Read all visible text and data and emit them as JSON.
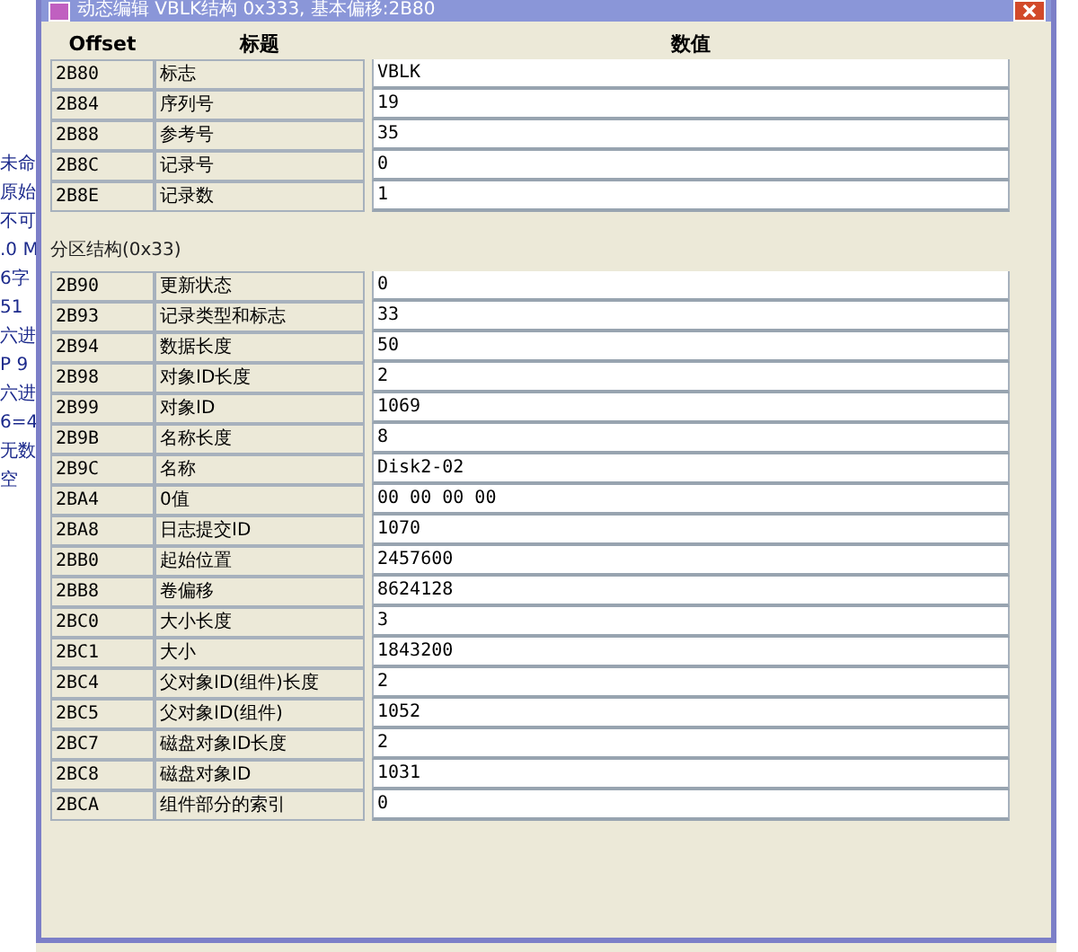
{
  "background_fragments": [
    "未命",
    "原始",
    "不可",
    ".0 M",
    "6字",
    "51",
    "六进",
    "P 9",
    "六进",
    "6=4",
    "无数",
    "空"
  ],
  "window": {
    "title": "动态编辑 VBLK结构 0x333, 基本偏移:2B80"
  },
  "columns": [
    "Offset",
    "标题",
    "数值"
  ],
  "header_rows": [
    {
      "offset": "2B80",
      "title": "标志",
      "value": "VBLK"
    },
    {
      "offset": "2B84",
      "title": "序列号",
      "value": "19"
    },
    {
      "offset": "2B88",
      "title": "参考号",
      "value": "35"
    },
    {
      "offset": "2B8C",
      "title": "记录号",
      "value": "0"
    },
    {
      "offset": "2B8E",
      "title": "记录数",
      "value": "1"
    }
  ],
  "section": {
    "title": "分区结构(0x33)",
    "rows": [
      {
        "offset": "2B90",
        "title": "更新状态",
        "value": "0"
      },
      {
        "offset": "2B93",
        "title": "记录类型和标志",
        "value": "33"
      },
      {
        "offset": "2B94",
        "title": "数据长度",
        "value": "50"
      },
      {
        "offset": "2B98",
        "title": "对象ID长度",
        "value": "2"
      },
      {
        "offset": "2B99",
        "title": "对象ID",
        "value": "1069"
      },
      {
        "offset": "2B9B",
        "title": "名称长度",
        "value": "8"
      },
      {
        "offset": "2B9C",
        "title": "名称",
        "value": "Disk2-02"
      },
      {
        "offset": "2BA4",
        "title": "0值",
        "value": "00 00 00 00"
      },
      {
        "offset": "2BA8",
        "title": "日志提交ID",
        "value": "1070"
      },
      {
        "offset": "2BB0",
        "title": "起始位置",
        "value": "2457600"
      },
      {
        "offset": "2BB8",
        "title": "卷偏移",
        "value": "8624128"
      },
      {
        "offset": "2BC0",
        "title": "大小长度",
        "value": "3"
      },
      {
        "offset": "2BC1",
        "title": "大小",
        "value": "1843200"
      },
      {
        "offset": "2BC4",
        "title": "父对象ID(组件)长度",
        "value": "2"
      },
      {
        "offset": "2BC5",
        "title": "父对象ID(组件)",
        "value": "1052"
      },
      {
        "offset": "2BC7",
        "title": "磁盘对象ID长度",
        "value": "2"
      },
      {
        "offset": "2BC8",
        "title": "磁盘对象ID",
        "value": "1031"
      },
      {
        "offset": "2BCA",
        "title": "组件部分的索引",
        "value": "0"
      }
    ]
  }
}
